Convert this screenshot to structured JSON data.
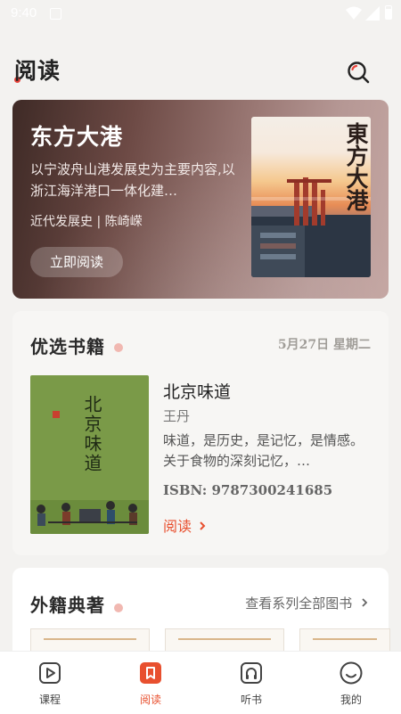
{
  "status_bar": {
    "time": "9:40"
  },
  "header": {
    "title": "阅读",
    "search_icon": "search-icon"
  },
  "hero": {
    "title": "东方大港",
    "description": "以宁波舟山港发展史为主要内容,以浙江海洋港口一体化建…",
    "meta": "近代发展史 | 陈崎嵘",
    "read_button": "立即阅读",
    "cover_text": "東方大港"
  },
  "featured": {
    "section_title": "优选书籍",
    "date": "5月27日 星期二",
    "book": {
      "title": "北京味道",
      "author": "王丹",
      "description": "味道，是历史，是记忆，是情感。关于食物的深刻记忆，…",
      "isbn": "ISBN: 9787300241685",
      "read_link": "阅读",
      "cover_text": "北京味道"
    }
  },
  "classics": {
    "section_title": "外籍典著",
    "more_link": "查看系列全部图书"
  },
  "bottom_nav": {
    "items": [
      {
        "label": "课程",
        "icon": "play-icon",
        "active": false
      },
      {
        "label": "阅读",
        "icon": "bookmark-icon",
        "active": true
      },
      {
        "label": "听书",
        "icon": "headphones-icon",
        "active": false
      },
      {
        "label": "我的",
        "icon": "smiley-icon",
        "active": false
      }
    ]
  },
  "colors": {
    "accent": "#e8502f",
    "title_dot": "#e8433a",
    "background": "#f3f2f0"
  }
}
